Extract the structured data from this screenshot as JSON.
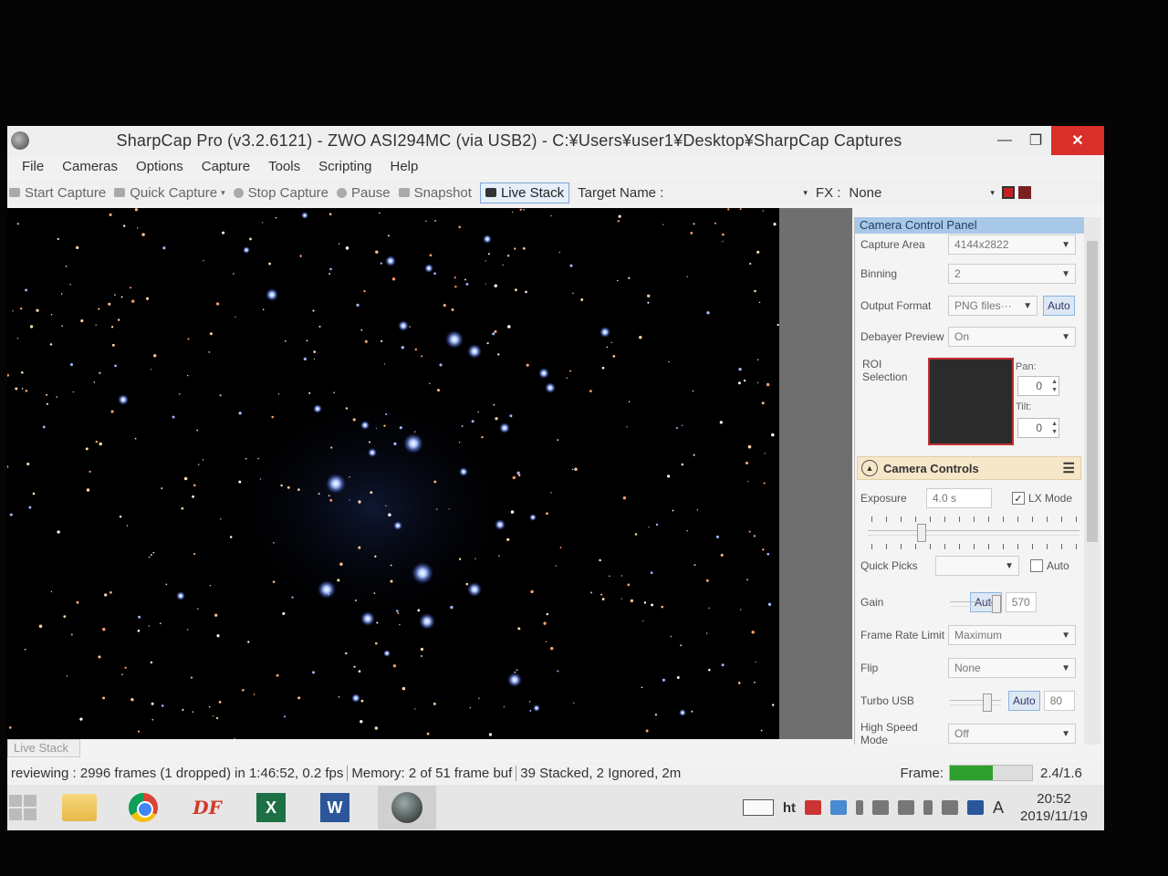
{
  "window": {
    "title": "SharpCap Pro (v3.2.6121) - ZWO ASI294MC (via USB2) - C:¥Users¥user1¥Desktop¥SharpCap Captures",
    "minimize": "—",
    "maximize": "❐",
    "close": "✕"
  },
  "menu": [
    "File",
    "Cameras",
    "Options",
    "Capture",
    "Tools",
    "Scripting",
    "Help"
  ],
  "toolbar": {
    "start_capture": "Start Capture",
    "quick_capture": "Quick Capture",
    "stop_capture": "Stop Capture",
    "pause": "Pause",
    "snapshot": "Snapshot",
    "live_stack": "Live Stack",
    "target_name_label": "Target Name :",
    "fx_label": "FX :",
    "fx_value": "None"
  },
  "panel": {
    "title": "Camera Control Panel",
    "capture_area": {
      "label": "Capture Area",
      "value": "4144x2822"
    },
    "binning": {
      "label": "Binning",
      "value": "2"
    },
    "output_format": {
      "label": "Output Format",
      "value": "PNG files···",
      "auto": "Auto"
    },
    "debayer_preview": {
      "label": "Debayer Preview",
      "value": "On"
    },
    "roi": {
      "label": "ROI Selection",
      "pan_label": "Pan:",
      "pan_value": "0",
      "tilt_label": "Tilt:",
      "tilt_value": "0"
    },
    "camera_controls": {
      "title": "Camera Controls",
      "exposure": {
        "label": "Exposure",
        "value": "4.0 s",
        "lx_mode": "LX Mode"
      },
      "quick_picks": {
        "label": "Quick Picks",
        "value": "",
        "auto": "Auto"
      },
      "gain": {
        "label": "Gain",
        "auto": "Auto",
        "value": "570"
      },
      "frame_rate_limit": {
        "label": "Frame Rate Limit",
        "value": "Maximum"
      },
      "flip": {
        "label": "Flip",
        "value": "None"
      },
      "turbo_usb": {
        "label": "Turbo USB",
        "auto": "Auto",
        "value": "80"
      },
      "high_speed_mode": {
        "label": "High Speed Mode",
        "value": "Off"
      }
    }
  },
  "bottom": {
    "live_stack_tab": "Live Stack",
    "status_preview": "reviewing : 2996 frames (1 dropped) in 1:46:52, 0.2 fps",
    "status_memory": "Memory: 2 of 51 frame buf",
    "status_stack": "39 Stacked, 2 Ignored, 2m",
    "frame_label": "Frame:",
    "frame_value": "2.4/1.6",
    "frame_fill": 0.52
  },
  "taskbar": {
    "apps": [
      "start",
      "file-explorer",
      "chrome",
      "df",
      "excel",
      "word",
      "sharpcap"
    ],
    "df_label": "DF",
    "excel_label": "X",
    "word_label": "W",
    "ime_label": "A",
    "ht_label": "ht",
    "time": "20:52",
    "date": "2019/11/19"
  },
  "colors": {
    "close_button": "#d9302b",
    "panel_header": "#a8c8e8",
    "section_header": "#f7e7c9",
    "frame_bar_fill": "#2da02d",
    "roi_border": "#c23030"
  }
}
